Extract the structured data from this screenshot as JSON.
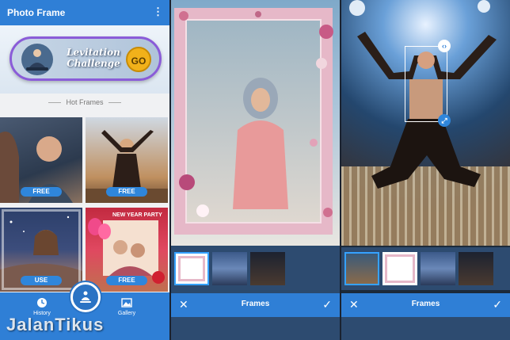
{
  "left_screen": {
    "app_title": "Photo Frame",
    "menu_icon": "more-vertical-icon",
    "banner": {
      "title": "Levitation Challenge",
      "button": "GO"
    },
    "section_title": "Hot Frames",
    "tiles": [
      {
        "tag": "FREE"
      },
      {
        "tag": "FREE"
      },
      {
        "tag": "USE"
      },
      {
        "tag": "FREE",
        "overlay": "NEW YEAR PARTY"
      }
    ],
    "nav": {
      "history": "History",
      "gallery": "Gallery"
    }
  },
  "middle_screen": {
    "bottom_title": "Frames",
    "close_icon": "close-icon",
    "confirm_icon": "check-icon"
  },
  "right_screen": {
    "bottom_title": "Frames",
    "close_icon": "close-icon",
    "confirm_icon": "check-icon"
  },
  "watermark": "JalanTikus",
  "colors": {
    "primary": "#2f7fd6",
    "accent": "#f1b11a",
    "frame_pink": "#e6b8c8"
  }
}
